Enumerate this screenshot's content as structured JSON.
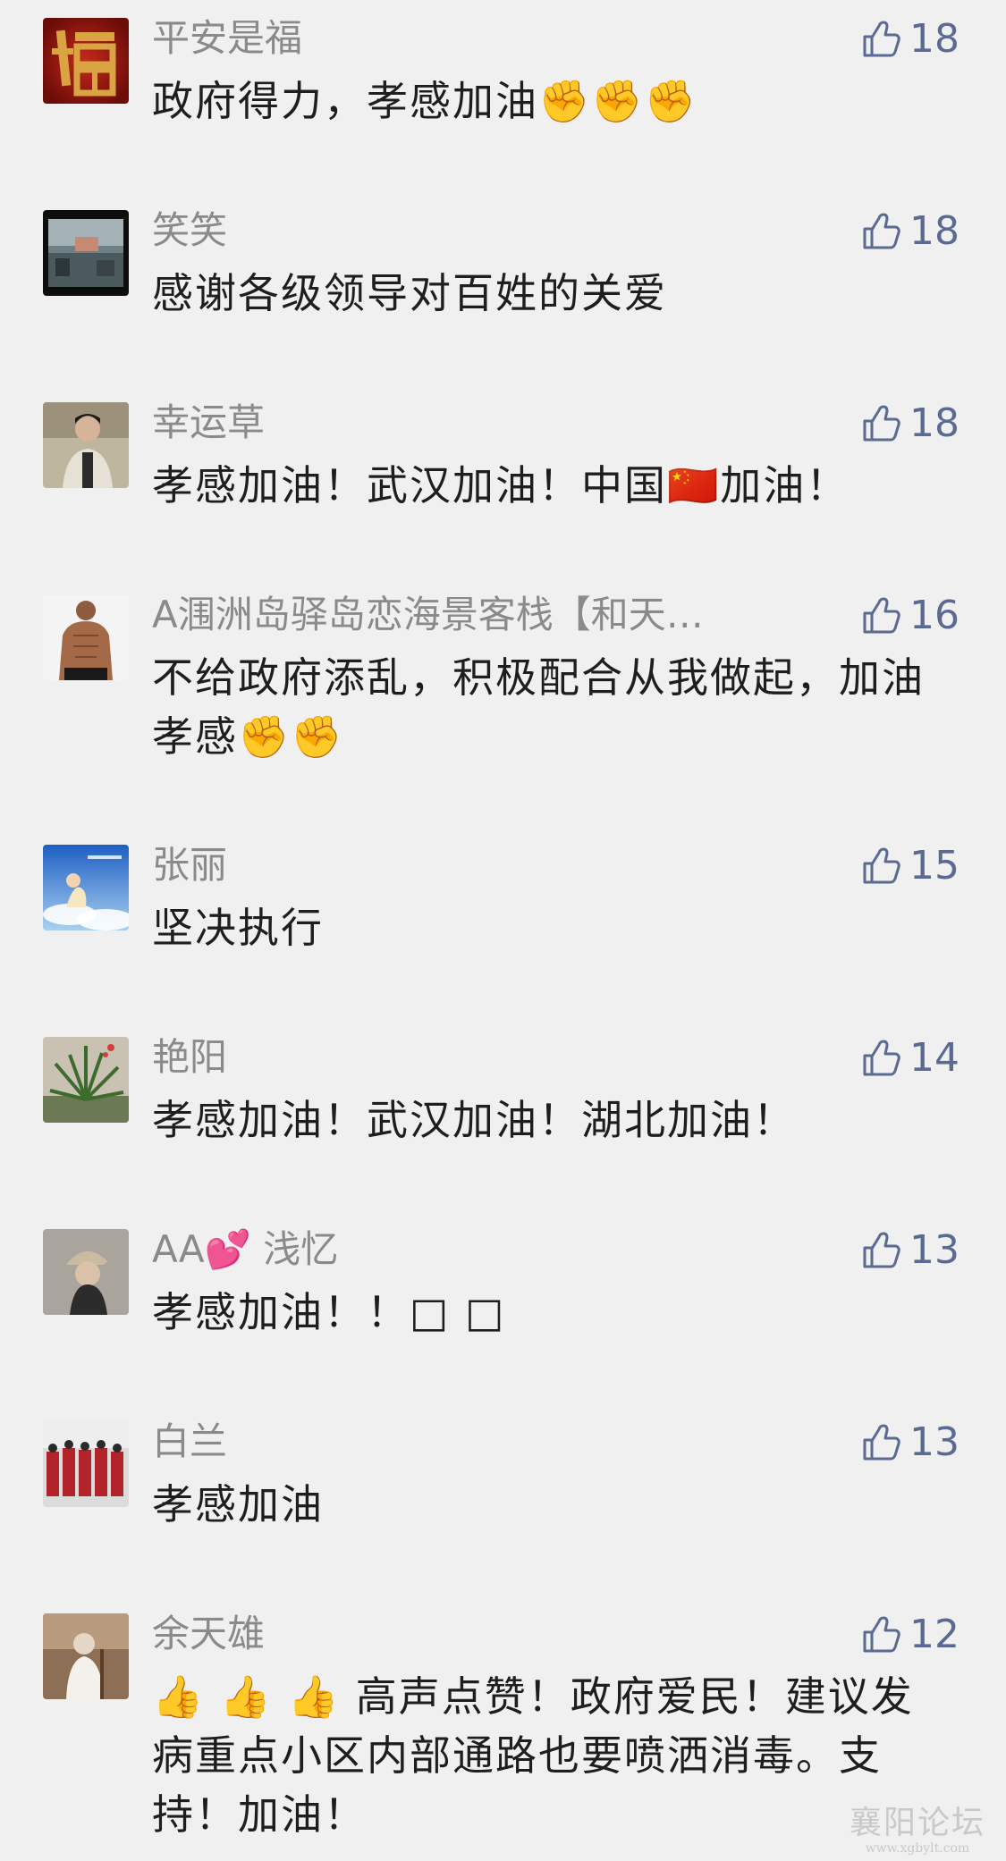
{
  "comments": [
    {
      "username": "平安是福",
      "content": "政府得力，孝感加油✊✊✊",
      "likes": "18",
      "avatar": "fu-character-avatar"
    },
    {
      "username": "笑笑",
      "content": "感谢各级领导对百姓的关爱",
      "likes": "18",
      "avatar": "building-photo-avatar"
    },
    {
      "username": "幸运草",
      "content": "孝感加油！武汉加油！中国🇨🇳加油！",
      "likes": "18",
      "avatar": "person-photo-avatar"
    },
    {
      "username": "A涠洲岛驿岛恋海景客栈【和天…",
      "content": "不给政府添乱，积极配合从我做起，加油孝感✊✊",
      "likes": "16",
      "avatar": "muscle-man-avatar"
    },
    {
      "username": "张丽",
      "content": "坚决执行",
      "likes": "15",
      "avatar": "sky-figure-avatar"
    },
    {
      "username": "艳阳",
      "content": "孝感加油！武汉加油！湖北加油！",
      "likes": "14",
      "avatar": "plant-photo-avatar"
    },
    {
      "username": "AA💕 浅忆",
      "content": "孝感加油！！□ □",
      "likes": "13",
      "avatar": "woman-cap-avatar"
    },
    {
      "username": "白兰",
      "content": "孝感加油",
      "likes": "13",
      "avatar": "group-photo-avatar"
    },
    {
      "username": "余天雄",
      "content": "👍 👍 👍 高声点赞！政府爱民！建议发病重点小区内部通路也要喷洒消毒。支持！加油！",
      "likes": "12",
      "avatar": "elder-photo-avatar"
    }
  ],
  "watermark": {
    "main": "襄阳论坛",
    "sub": "www.xgbylt.com"
  },
  "colors": {
    "background": "#f0f0f0",
    "username": "#8a8a8a",
    "content": "#1e1e1e",
    "like": "#5b6a92"
  }
}
